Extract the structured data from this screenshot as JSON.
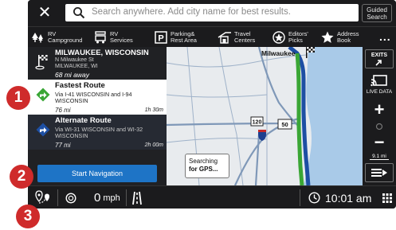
{
  "topbar": {
    "search_placeholder": "Search anywhere. Add city name for best results.",
    "guided_line1": "Guided",
    "guided_line2": "Search"
  },
  "categories": [
    {
      "icon": "rv-campground-icon",
      "line1": "RV",
      "line2": "Campground"
    },
    {
      "icon": "rv-services-icon",
      "line1": "RV",
      "line2": "Services"
    },
    {
      "icon": "parking-icon",
      "line1": "Parking&",
      "line2": "Rest Area"
    },
    {
      "icon": "travel-centers-icon",
      "line1": "Travel",
      "line2": "Centers"
    },
    {
      "icon": "editors-picks-icon",
      "line1": "Editors'",
      "line2": "Picks"
    },
    {
      "icon": "star-icon",
      "line1": "Address",
      "line2": "Book"
    }
  ],
  "more_label": "...",
  "destination": {
    "name": "MILWAUKEE, WISCONSIN",
    "street": "N Milwaukee St",
    "city": "MILWAUKEE, WI",
    "distance": "68 mi away"
  },
  "routes": [
    {
      "title": "Fastest Route",
      "via": "Via I-41 WISCONSIN and I-94 WISCONSIN",
      "distance": "76 mi",
      "time": "1h 30m"
    },
    {
      "title": "Alternate Route",
      "via": "Via WI-31 WISCONSIN and WI-32 WISCONSIN",
      "distance": "77 mi",
      "time": "2h 00m"
    }
  ],
  "start_button": "Start Navigation",
  "map": {
    "city_label": "Milwaukee",
    "shield_120": "120",
    "shield_50": "50",
    "searching_line1": "Searching",
    "searching_line2": "for GPS..."
  },
  "right_controls": {
    "exits": "EXITS",
    "live_data": "LIVE DATA",
    "zoom_in": "+",
    "zoom_out": "−",
    "scale": "9.1 mi"
  },
  "bottombar": {
    "speed_value": "0",
    "speed_unit": "mph",
    "time": "10:01 am"
  },
  "callouts": [
    "1",
    "2",
    "3"
  ],
  "colors": {
    "fastest_route": "#3aa635",
    "alternate_route": "#1d4fa3",
    "start_button": "#1e74c6",
    "callout": "#cf2b2b"
  }
}
